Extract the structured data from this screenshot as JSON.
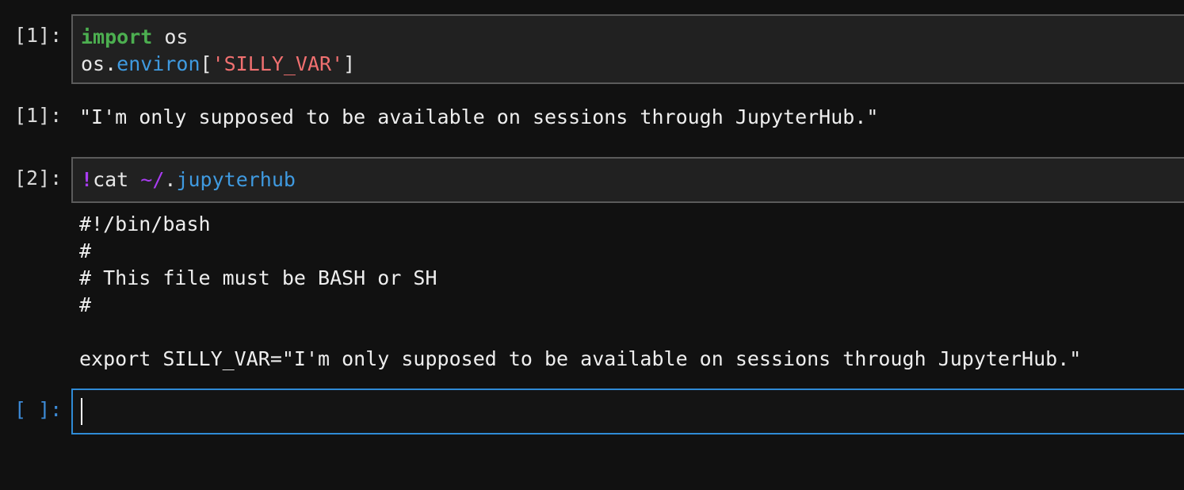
{
  "cells": [
    {
      "prompt": "[1]:",
      "code": {
        "line1_kw": "import",
        "line1_rest": " os",
        "line2_obj": "os.",
        "line2_attr": "environ",
        "line2_open": "[",
        "line2_str": "'SILLY_VAR'",
        "line2_close": "]"
      },
      "output_prompt": "[1]:",
      "output": "\"I'm only supposed to be available on sessions through JupyterHub.\""
    },
    {
      "prompt": "[2]:",
      "code": {
        "bang": "!",
        "cmd": "cat ",
        "tilde": "~/",
        "dot": ".",
        "path": "jupyterhub"
      },
      "output_lines": [
        "#!/bin/bash",
        "#",
        "# This file must be BASH or SH",
        "#",
        "",
        "export SILLY_VAR=\"I'm only supposed to be available on sessions through JupyterHub.\""
      ]
    },
    {
      "prompt": "[ ]:",
      "code": ""
    }
  ],
  "colors": {
    "background": "#111111",
    "active_border": "#2f8bd6",
    "keyword": "#4caf50",
    "attribute": "#3f9ae0",
    "string": "#f07070",
    "magic": "#a93cf2"
  }
}
